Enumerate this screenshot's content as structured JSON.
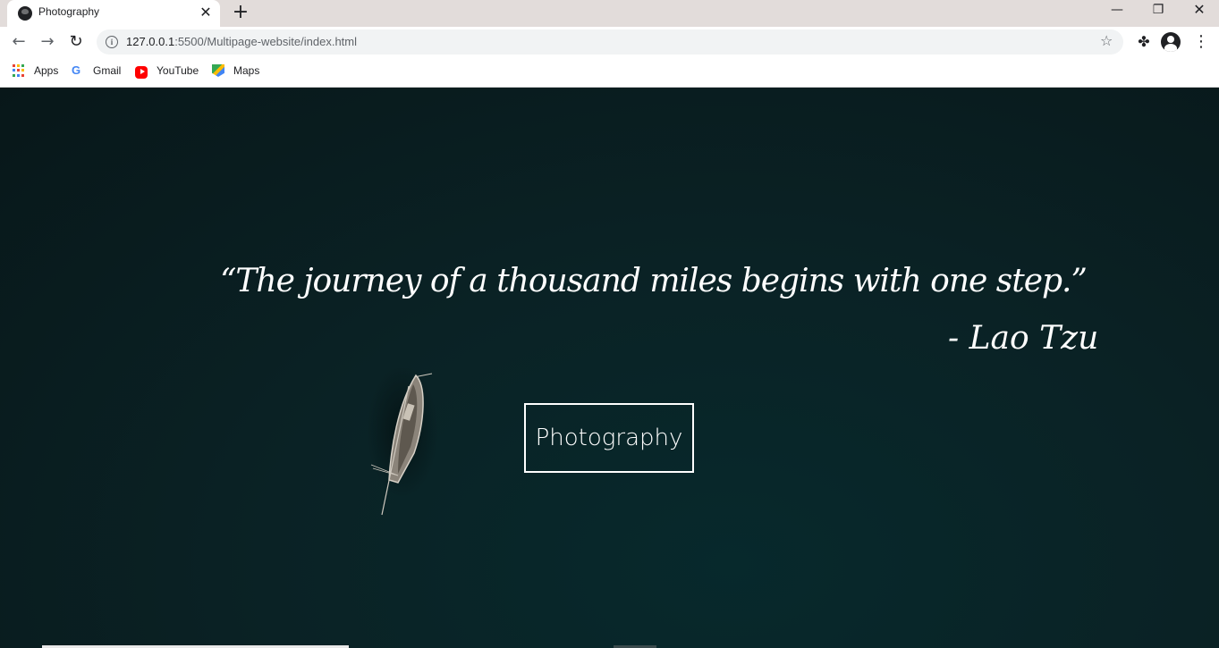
{
  "browser": {
    "tab": {
      "title": "Photography",
      "close": "✕"
    },
    "new_tab": "+",
    "window_controls": {
      "minimize": "—",
      "maximize": "❐",
      "close": "✕"
    },
    "nav": {
      "back": "←",
      "forward": "→",
      "reload": "↻"
    },
    "address": {
      "host": "127.0.0.1",
      "path": ":5500/Multipage-website/index.html",
      "info_icon": "i",
      "star": "☆"
    },
    "toolbar_icons": {
      "extensions": "✤",
      "menu": "⋮"
    },
    "bookmarks": [
      {
        "label": "Apps",
        "icon": "apps-grid-icon"
      },
      {
        "label": "Gmail",
        "icon": "google-icon"
      },
      {
        "label": "YouTube",
        "icon": "youtube-icon"
      },
      {
        "label": "Maps",
        "icon": "maps-icon"
      }
    ],
    "apps_grid_colors": [
      "#ea4335",
      "#fbbc04",
      "#34a853",
      "#4285f4",
      "#ea4335",
      "#fbbc04",
      "#34a853",
      "#4285f4",
      "#ea4335"
    ]
  },
  "hero": {
    "quote": "“The journey of a thousand miles begins with one step.”",
    "author": "- Lao Tzu",
    "button_label": "Photography"
  }
}
